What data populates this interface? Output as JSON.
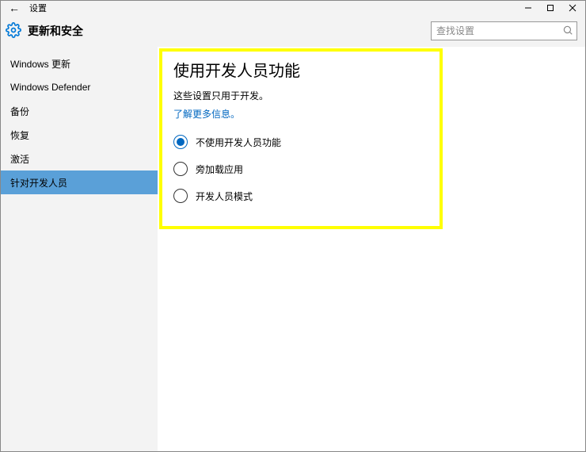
{
  "window": {
    "app_name": "设置"
  },
  "header": {
    "title": "更新和安全",
    "search_placeholder": "查找设置"
  },
  "sidebar": {
    "items": [
      {
        "label": "Windows 更新",
        "selected": false
      },
      {
        "label": "Windows Defender",
        "selected": false
      },
      {
        "label": "备份",
        "selected": false
      },
      {
        "label": "恢复",
        "selected": false
      },
      {
        "label": "激活",
        "selected": false
      },
      {
        "label": "针对开发人员",
        "selected": true
      }
    ]
  },
  "content": {
    "heading": "使用开发人员功能",
    "description": "这些设置只用于开发。",
    "link_text": "了解更多信息。",
    "options": [
      {
        "label": "不使用开发人员功能",
        "checked": true
      },
      {
        "label": "旁加载应用",
        "checked": false
      },
      {
        "label": "开发人员模式",
        "checked": false
      }
    ]
  }
}
